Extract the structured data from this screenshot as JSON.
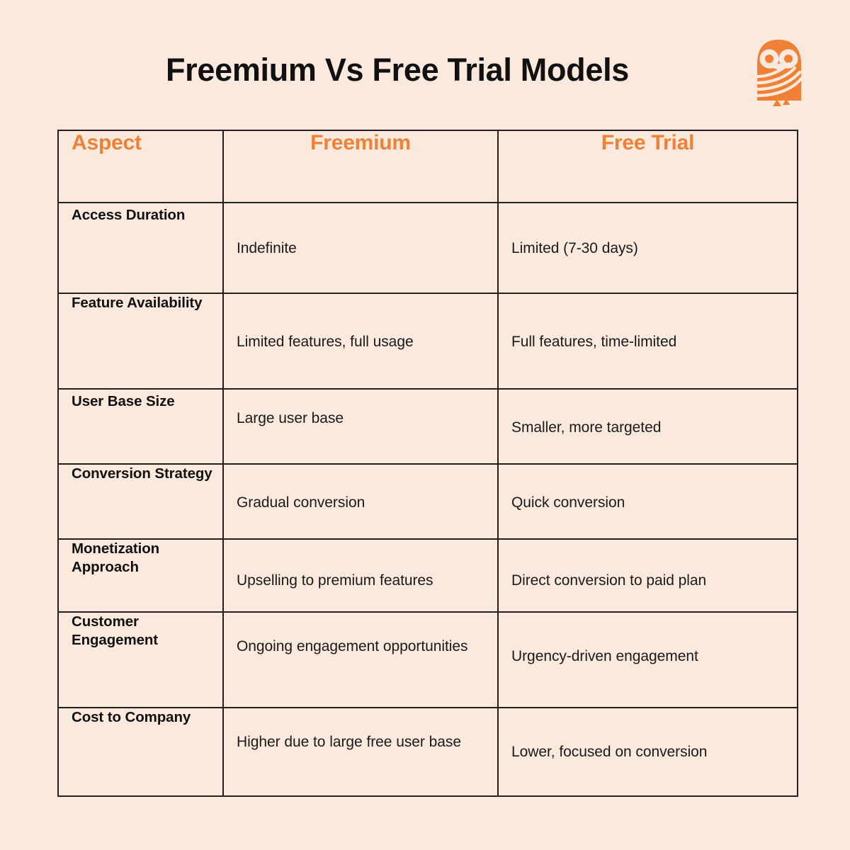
{
  "header": {
    "title": "Freemium Vs Free Trial Models",
    "logo": {
      "name": "owl-logo",
      "color": "#EF8136"
    }
  },
  "theme": {
    "background": "#FCE9DD",
    "accent": "#EF8136",
    "text": "#111111",
    "border": "#231f20"
  },
  "table": {
    "columns": [
      "Aspect",
      "Freemium",
      "Free Trial"
    ],
    "rows": [
      {
        "aspect": "Access Duration",
        "freemium": "Indefinite",
        "free_trial": "Limited (7-30 days)"
      },
      {
        "aspect": "Feature Availability",
        "freemium": "Limited features, full usage",
        "free_trial": "Full features, time-limited"
      },
      {
        "aspect": "User Base Size",
        "freemium": "Large user base",
        "free_trial": "Smaller, more targeted"
      },
      {
        "aspect": "Conversion Strategy",
        "freemium": "Gradual conversion",
        "free_trial": "Quick conversion"
      },
      {
        "aspect": "Monetization Approach",
        "freemium": "Upselling to premium features",
        "free_trial": "Direct conversion to paid plan"
      },
      {
        "aspect": "Customer Engagement",
        "freemium": "Ongoing engagement opportunities",
        "free_trial": "Urgency-driven engagement"
      },
      {
        "aspect": "Cost to Company",
        "freemium": "Higher due to large free user base",
        "free_trial": "Lower, focused on conversion"
      }
    ]
  }
}
